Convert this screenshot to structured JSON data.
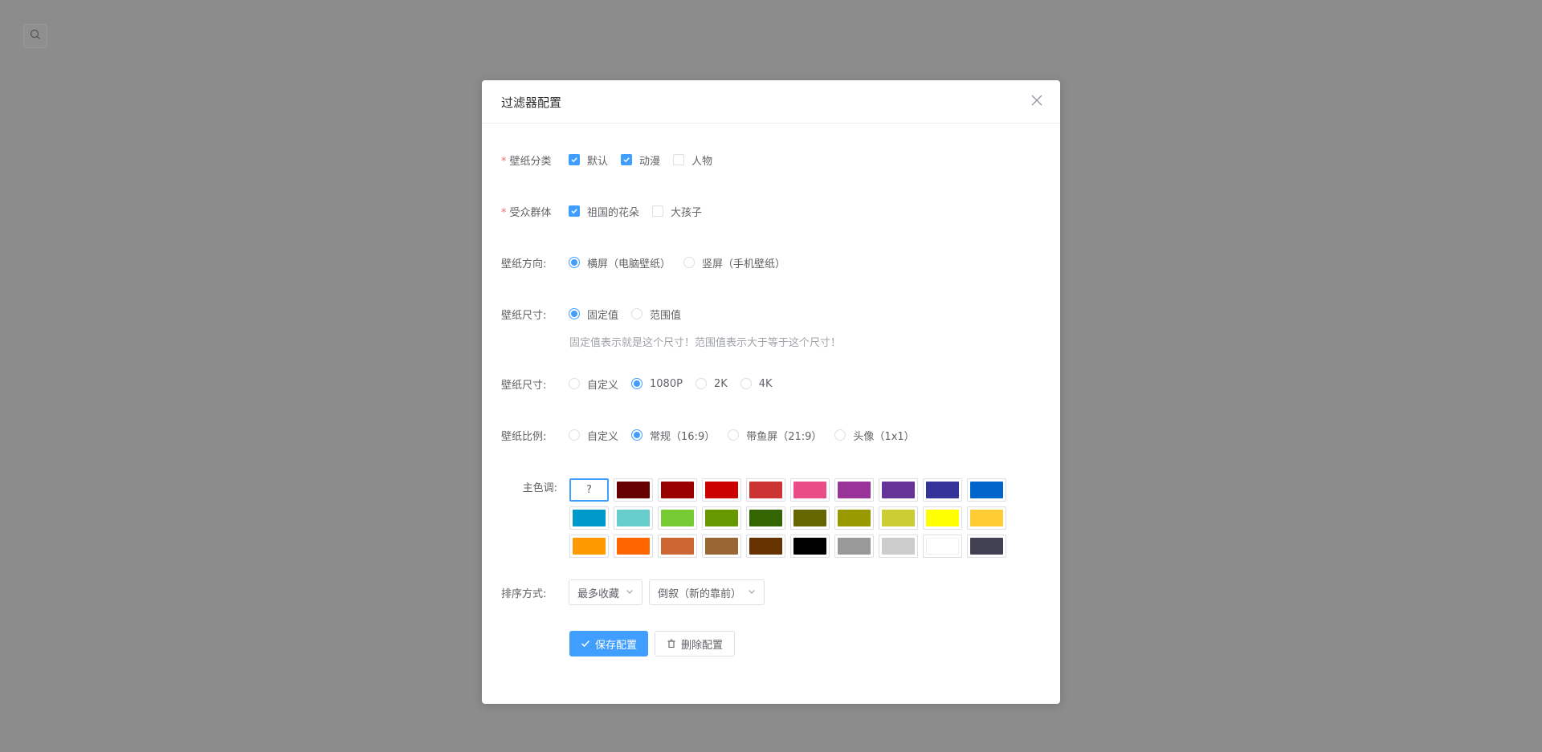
{
  "dialog": {
    "title": "过滤器配置"
  },
  "form": {
    "category": {
      "required_mark": "*",
      "label": "壁纸分类",
      "options": [
        {
          "label": "默认",
          "checked": true
        },
        {
          "label": "动漫",
          "checked": true
        },
        {
          "label": "人物",
          "checked": false
        }
      ]
    },
    "audience": {
      "required_mark": "*",
      "label": "受众群体",
      "options": [
        {
          "label": "祖国的花朵",
          "checked": true
        },
        {
          "label": "大孩子",
          "checked": false
        }
      ]
    },
    "orientation": {
      "label": "壁纸方向:",
      "options": [
        {
          "label": "横屏（电脑壁纸）",
          "checked": true
        },
        {
          "label": "竖屏（手机壁纸）",
          "checked": false
        }
      ]
    },
    "size_mode": {
      "label": "壁纸尺寸:",
      "options": [
        {
          "label": "固定值",
          "checked": true
        },
        {
          "label": "范围值",
          "checked": false
        }
      ],
      "hint": "固定值表示就是这个尺寸！范围值表示大于等于这个尺寸！"
    },
    "size": {
      "label": "壁纸尺寸:",
      "options": [
        {
          "label": "自定义",
          "checked": false
        },
        {
          "label": "1080P",
          "checked": true
        },
        {
          "label": "2K",
          "checked": false
        },
        {
          "label": "4K",
          "checked": false
        }
      ]
    },
    "ratio": {
      "label": "壁纸比例:",
      "options": [
        {
          "label": "自定义",
          "checked": false
        },
        {
          "label": "常规（16:9）",
          "checked": true
        },
        {
          "label": "带鱼屏（21:9）",
          "checked": false
        },
        {
          "label": "头像（1x1）",
          "checked": false
        }
      ]
    },
    "color": {
      "label": "主色调:",
      "unset_symbol": "?",
      "swatches": [
        "#660000",
        "#990000",
        "#cc0000",
        "#cc3333",
        "#ea4c88",
        "#993399",
        "#663399",
        "#333399",
        "#0066cc",
        "#0099cc",
        "#66cccc",
        "#77cc33",
        "#669900",
        "#336600",
        "#666600",
        "#999900",
        "#cccc33",
        "#ffff00",
        "#ffcc33",
        "#ff9900",
        "#ff6600",
        "#cc6633",
        "#996633",
        "#663300",
        "#000000",
        "#999999",
        "#cccccc",
        "#ffffff",
        "#424153"
      ]
    },
    "sort": {
      "label": "排序方式:",
      "field_value": "最多收藏",
      "order_value": "倒叙（新的靠前）"
    },
    "actions": {
      "save_label": "保存配置",
      "delete_label": "删除配置"
    }
  },
  "colors": {
    "primary": "#409eff",
    "overlay": "#8c8c8c"
  }
}
